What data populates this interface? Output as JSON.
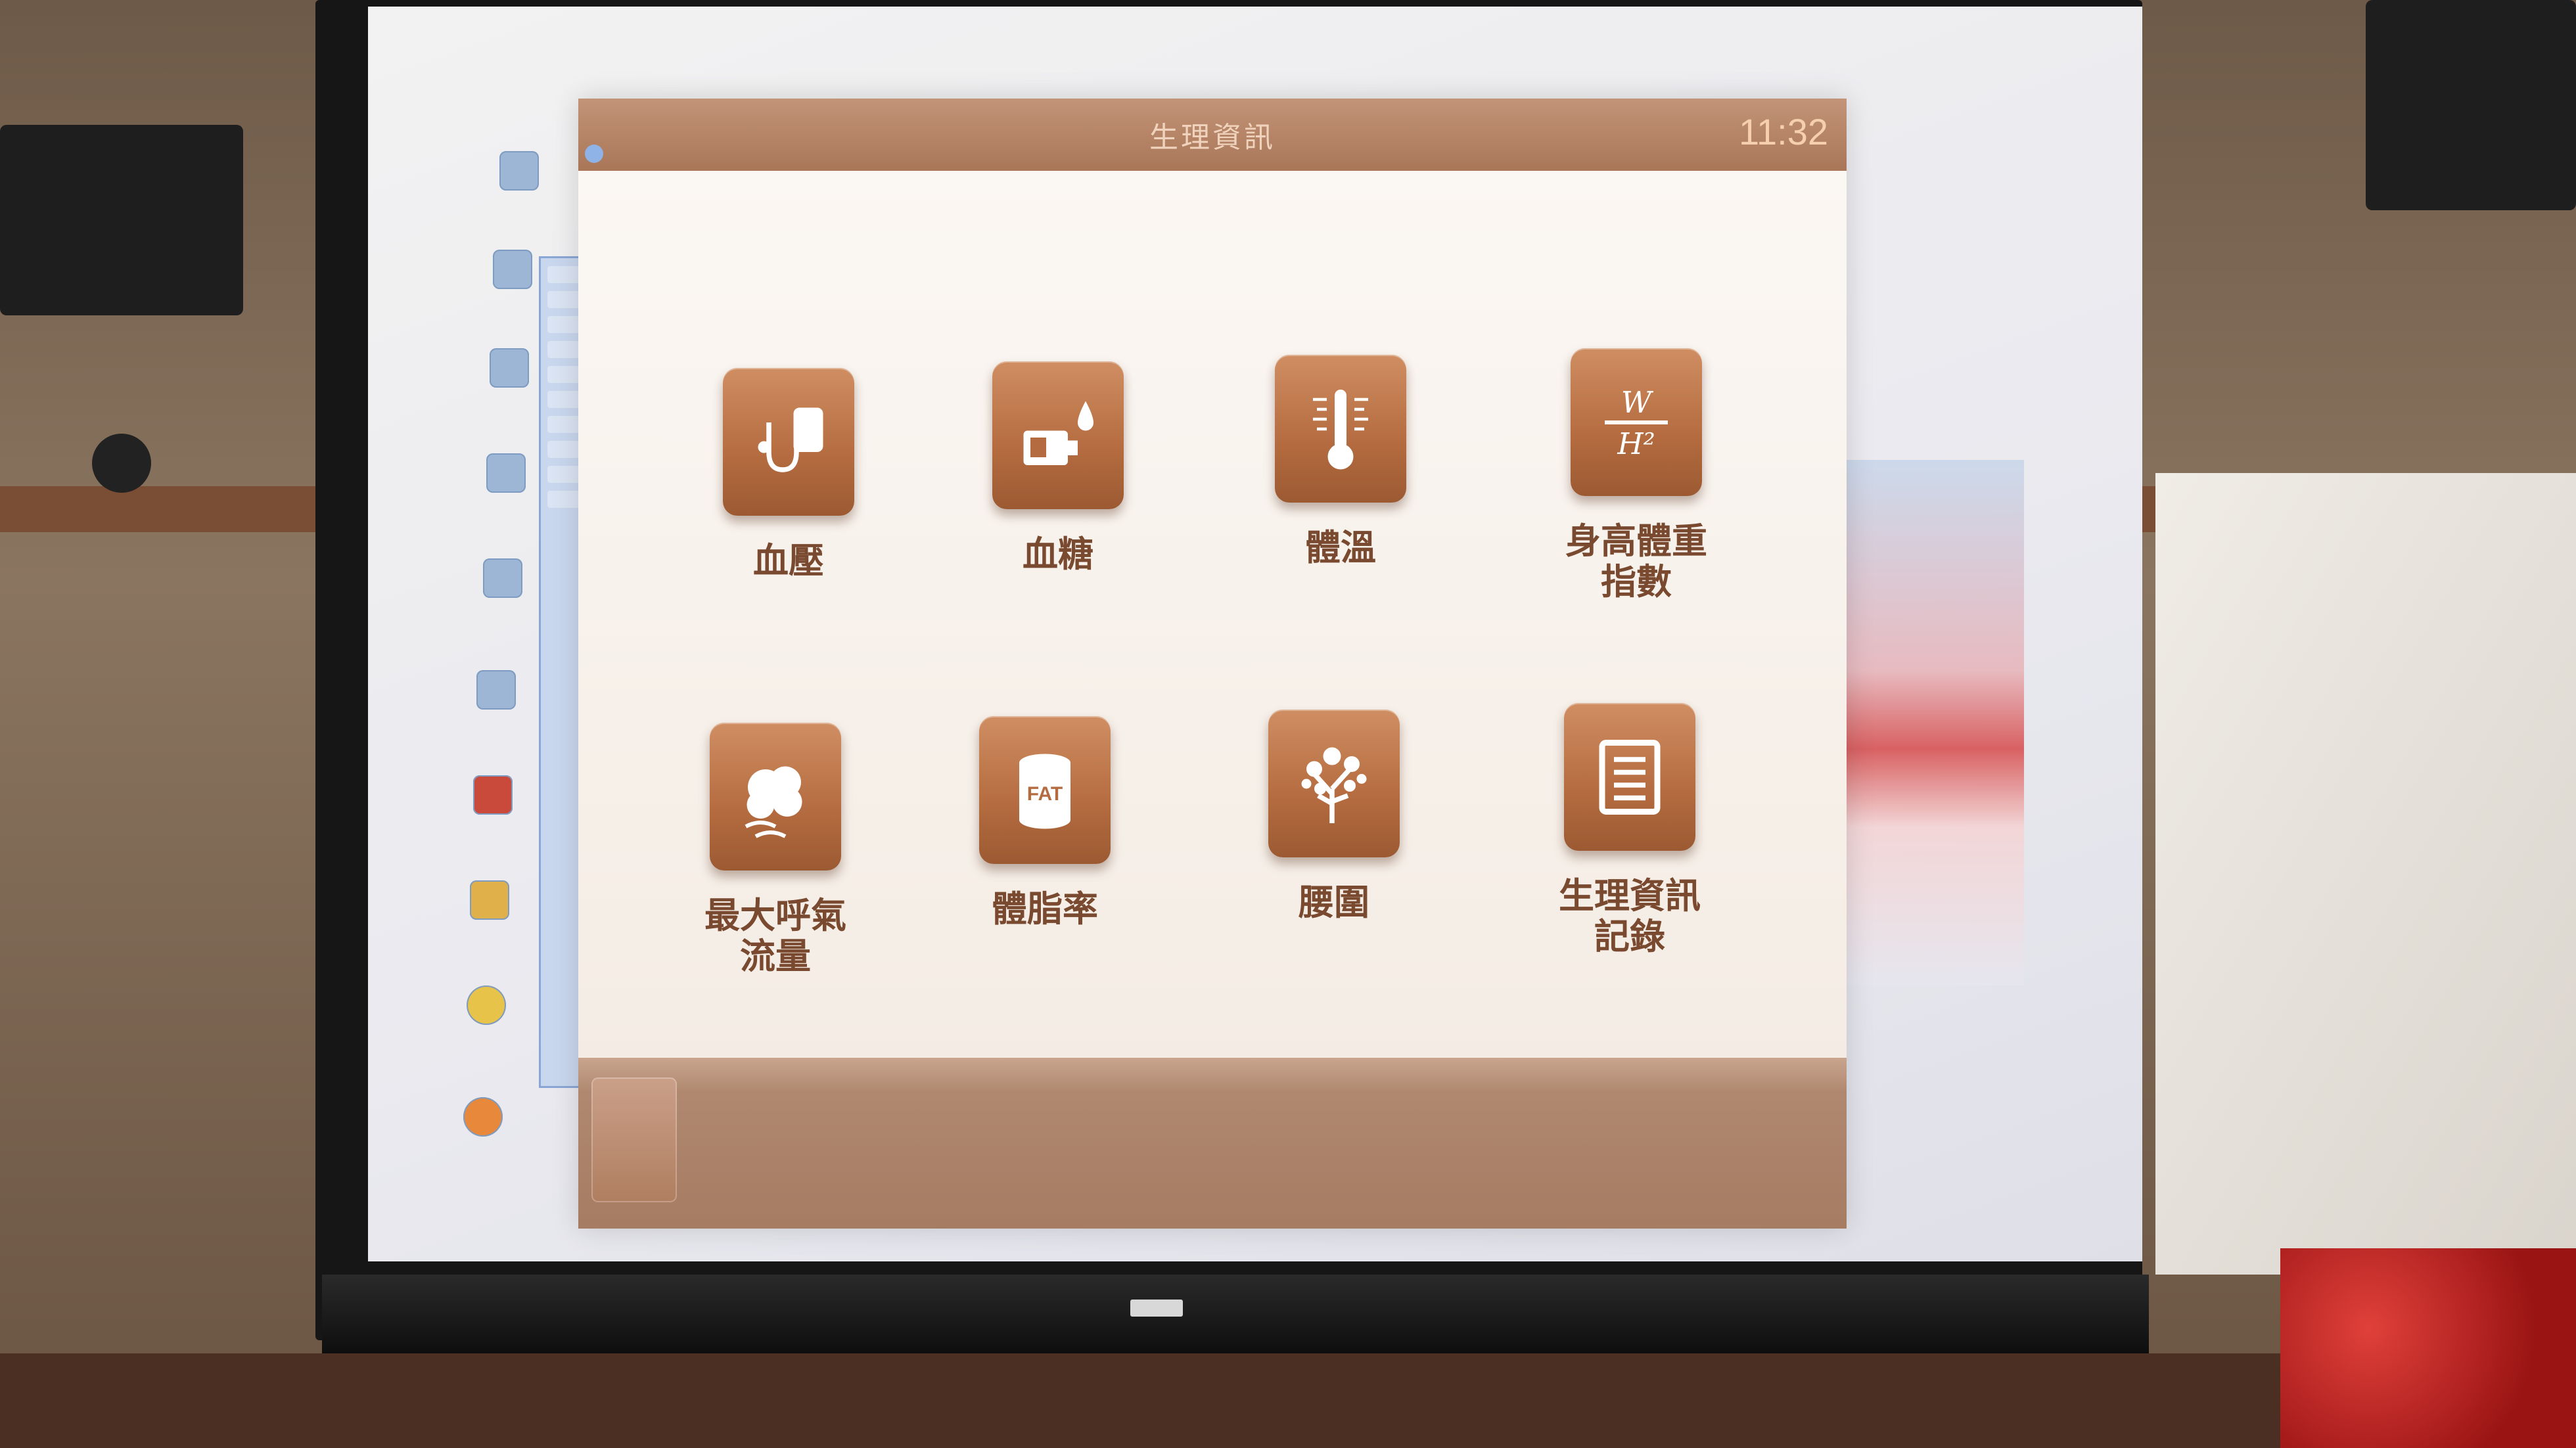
{
  "app": {
    "title": "生理資訊",
    "clock": "11:32"
  },
  "tiles": [
    {
      "label": "血壓",
      "icon": "blood-pressure-cuff-icon"
    },
    {
      "label": "血糖",
      "icon": "glucose-meter-icon"
    },
    {
      "label": "體溫",
      "icon": "thermometer-icon"
    },
    {
      "label": "身高體重\n指數",
      "icon": "bmi-formula-icon"
    },
    {
      "label": "最大呼氣\n流量",
      "icon": "breath-cloud-icon"
    },
    {
      "label": "體脂率",
      "icon": "fat-cylinder-icon"
    },
    {
      "label": "腰圍",
      "icon": "tree-icon"
    },
    {
      "label": "生理資訊\n記錄",
      "icon": "document-icon"
    }
  ],
  "bmi_formula": {
    "top": "W",
    "bottom": "H²"
  },
  "fat_text": "FAT",
  "colors": {
    "tile_brown": "#b46b3f",
    "titlebar": "#a97658",
    "label": "#7a4a30"
  }
}
